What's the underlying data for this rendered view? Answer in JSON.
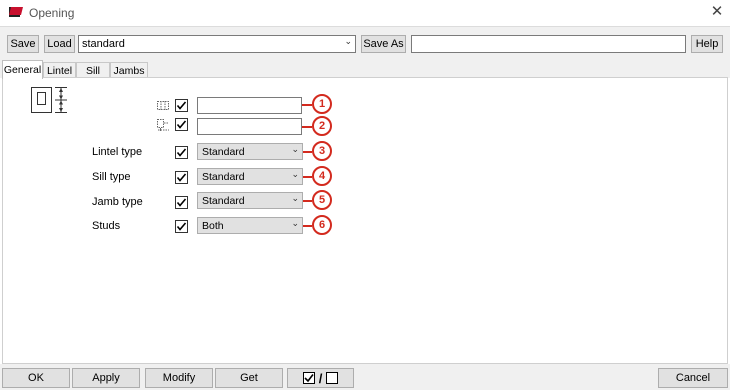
{
  "window": {
    "title": "Opening"
  },
  "toolbar": {
    "save_label": "Save",
    "load_label": "Load",
    "preset_value": "standard",
    "save_as_label": "Save As",
    "save_as_value": "",
    "help_label": "Help"
  },
  "tabs": [
    {
      "label": "General",
      "active": true
    },
    {
      "label": "Lintel",
      "active": false
    },
    {
      "label": "Sill",
      "active": false
    },
    {
      "label": "Jambs",
      "active": false
    }
  ],
  "general": {
    "rows": [
      {
        "marker": "1",
        "label": "",
        "icon": "width-dimension-icon",
        "checked": true,
        "kind": "text",
        "value": ""
      },
      {
        "marker": "2",
        "label": "",
        "icon": "height-dimension-icon",
        "checked": true,
        "kind": "text",
        "value": ""
      },
      {
        "marker": "3",
        "label": "Lintel type",
        "checked": true,
        "kind": "combo",
        "value": "Standard"
      },
      {
        "marker": "4",
        "label": "Sill type",
        "checked": true,
        "kind": "combo",
        "value": "Standard"
      },
      {
        "marker": "5",
        "label": "Jamb type",
        "checked": true,
        "kind": "combo",
        "value": "Standard"
      },
      {
        "marker": "6",
        "label": "Studs",
        "checked": true,
        "kind": "combo",
        "value": "Both"
      }
    ]
  },
  "bottom": {
    "ok_label": "OK",
    "apply_label": "Apply",
    "modify_label": "Modify",
    "get_label": "Get",
    "toggle_separator": "/",
    "cancel_label": "Cancel"
  },
  "colors": {
    "marker_red": "#d32a1e",
    "app_icon_red": "#c8102e"
  }
}
